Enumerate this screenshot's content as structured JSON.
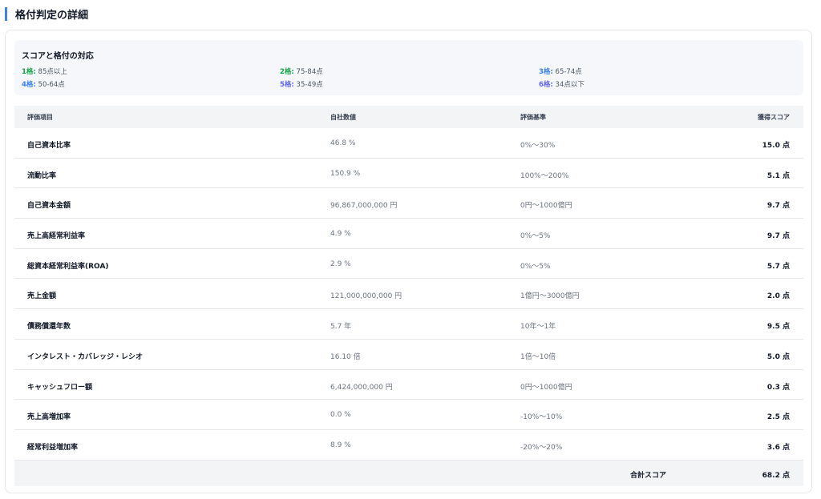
{
  "title": "格付判定の詳細",
  "colors": {
    "accent": "#3b82f6",
    "grade_green": "#16a34a",
    "grade_blue": "#3b82f6",
    "grade_purple": "#6366f1"
  },
  "legend": {
    "title": "スコアと格付の対応",
    "items": [
      {
        "grade": "1格:",
        "range": " 85点以上"
      },
      {
        "grade": "2格:",
        "range": " 75-84点"
      },
      {
        "grade": "3格:",
        "range": " 65-74点"
      },
      {
        "grade": "4格:",
        "range": " 50-64点"
      },
      {
        "grade": "5格:",
        "range": " 35-49点"
      },
      {
        "grade": "6格:",
        "range": " 34点以下"
      }
    ]
  },
  "table": {
    "headers": [
      "評価項目",
      "自社数値",
      "評価基準",
      "獲得スコア"
    ],
    "rows": [
      {
        "item": "自己資本比率",
        "value": "46.8 %",
        "criteria": "0%〜30%",
        "score": "15.0 点"
      },
      {
        "item": "流動比率",
        "value": "150.9 %",
        "criteria": "100%〜200%",
        "score": "5.1 点"
      },
      {
        "item": "自己資本金額",
        "value": "96,867,000,000 円",
        "criteria": "0円〜1000億円",
        "score": "9.7 点"
      },
      {
        "item": "売上高経常利益率",
        "value": "4.9 %",
        "criteria": "0%〜5%",
        "score": "9.7 点"
      },
      {
        "item": "総資本経常利益率(ROA)",
        "value": "2.9 %",
        "criteria": "0%〜5%",
        "score": "5.7 点"
      },
      {
        "item": "売上金額",
        "value": "121,000,000,000 円",
        "criteria": "1億円〜3000億円",
        "score": "2.0 点"
      },
      {
        "item": "債務償還年数",
        "value": "5.7 年",
        "criteria": "10年〜1年",
        "score": "9.5 点"
      },
      {
        "item": "インタレスト・カバレッジ・レシオ",
        "value": "16.10 倍",
        "criteria": "1倍〜10倍",
        "score": "5.0 点"
      },
      {
        "item": "キャッシュフロー額",
        "value": "6,424,000,000 円",
        "criteria": "0円〜1000億円",
        "score": "0.3 点"
      },
      {
        "item": "売上高増加率",
        "value": "0.0 %",
        "criteria": "-10%〜10%",
        "score": "2.5 点"
      },
      {
        "item": "経常利益増加率",
        "value": "8.9 %",
        "criteria": "-20%〜20%",
        "score": "3.6 点"
      }
    ],
    "total_label": "合計スコア",
    "total_value": "68.2 点"
  }
}
